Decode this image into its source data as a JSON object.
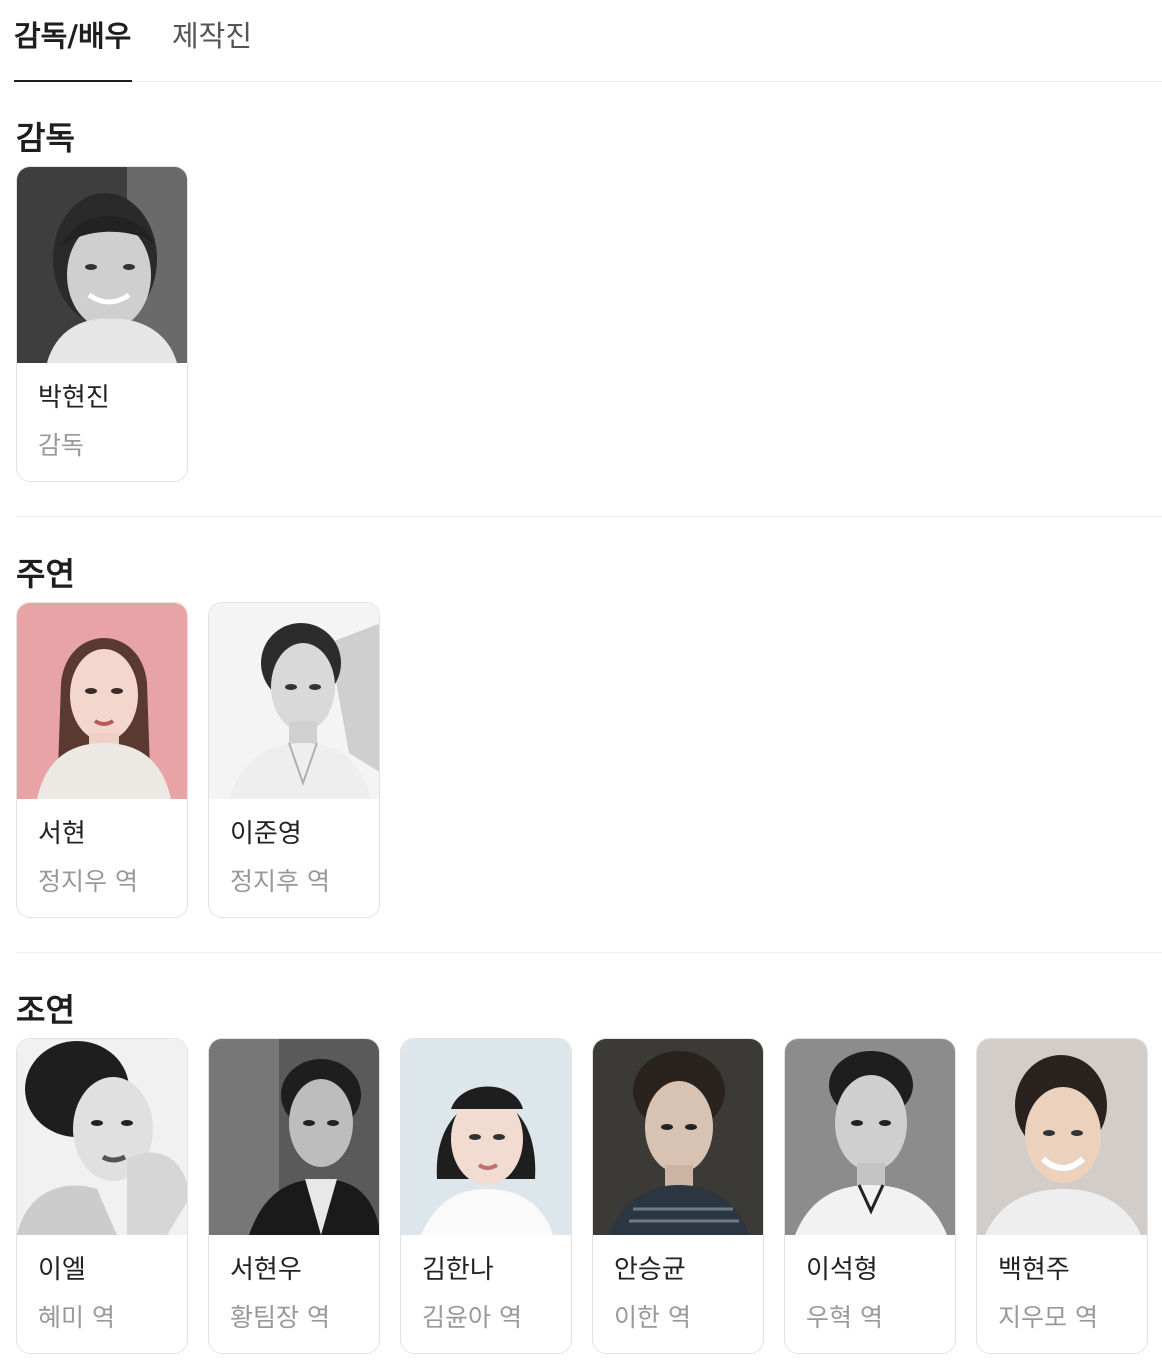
{
  "tabs": [
    {
      "label": "감독/배우",
      "active": true
    },
    {
      "label": "제작진",
      "active": false
    }
  ],
  "sections": {
    "director": {
      "title": "감독",
      "people": [
        {
          "name": "박현진",
          "role": "감독"
        }
      ]
    },
    "lead": {
      "title": "주연",
      "people": [
        {
          "name": "서현",
          "role": "정지우 역"
        },
        {
          "name": "이준영",
          "role": "정지후 역"
        }
      ]
    },
    "supporting": {
      "title": "조연",
      "people": [
        {
          "name": "이엘",
          "role": "혜미 역"
        },
        {
          "name": "서현우",
          "role": "황팀장 역"
        },
        {
          "name": "김한나",
          "role": "김윤아 역"
        },
        {
          "name": "안승균",
          "role": "이한 역"
        },
        {
          "name": "이석형",
          "role": "우혁 역"
        },
        {
          "name": "백현주",
          "role": "지우모 역"
        }
      ]
    }
  },
  "photo_palette": {
    "gray_bg": "#d8d8d8",
    "pink_bg": "#e8a3a6",
    "dark_bg": "#4a4a4a",
    "light_bg": "#dde6ea"
  }
}
